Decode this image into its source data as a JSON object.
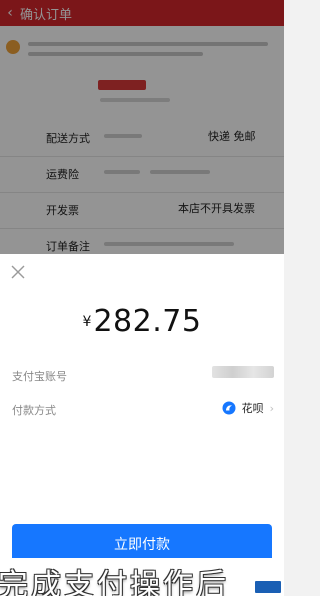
{
  "order_page": {
    "title": "确认订单",
    "rows": [
      {
        "label": "配送方式",
        "value": "快递 免邮"
      },
      {
        "label": "运费险",
        "value": ""
      },
      {
        "label": "开发票",
        "value": "本店不开具发票"
      },
      {
        "label": "订单备注",
        "value": ""
      }
    ]
  },
  "payment": {
    "currency_symbol": "¥",
    "amount": "282.75",
    "account_label": "支付宝账号",
    "method_label": "付款方式",
    "method_value": "花呗",
    "pay_button": "立即付款"
  },
  "caption": {
    "text": "完成支付操作后"
  },
  "colors": {
    "topbar": "#d4262c",
    "pay_button": "#1677ff",
    "huabei": "#1677ff"
  },
  "icons": {
    "back": "chevron-left-icon",
    "close": "close-icon",
    "method": "huabei-icon",
    "chevron": "chevron-right-icon"
  }
}
